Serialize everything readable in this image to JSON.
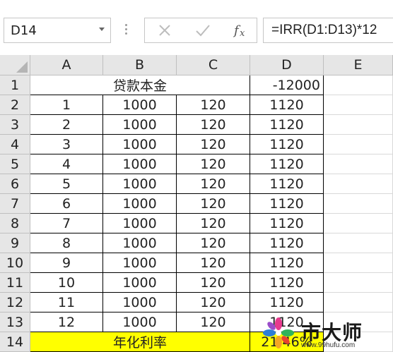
{
  "formula_bar": {
    "name_box": "D14",
    "formula": "=IRR(D1:D13)*12"
  },
  "columns": [
    "A",
    "B",
    "C",
    "D",
    "E"
  ],
  "rows": [
    {
      "num": "1",
      "a": "",
      "b": "贷款本金",
      "c": "",
      "d": "-12000"
    },
    {
      "num": "2",
      "a": "1",
      "b": "1000",
      "c": "120",
      "d": "1120"
    },
    {
      "num": "3",
      "a": "2",
      "b": "1000",
      "c": "120",
      "d": "1120"
    },
    {
      "num": "4",
      "a": "3",
      "b": "1000",
      "c": "120",
      "d": "1120"
    },
    {
      "num": "5",
      "a": "4",
      "b": "1000",
      "c": "120",
      "d": "1120"
    },
    {
      "num": "6",
      "a": "5",
      "b": "1000",
      "c": "120",
      "d": "1120"
    },
    {
      "num": "7",
      "a": "6",
      "b": "1000",
      "c": "120",
      "d": "1120"
    },
    {
      "num": "8",
      "a": "7",
      "b": "1000",
      "c": "120",
      "d": "1120"
    },
    {
      "num": "9",
      "a": "8",
      "b": "1000",
      "c": "120",
      "d": "1120"
    },
    {
      "num": "10",
      "a": "9",
      "b": "1000",
      "c": "120",
      "d": "1120"
    },
    {
      "num": "11",
      "a": "10",
      "b": "1000",
      "c": "120",
      "d": "1120"
    },
    {
      "num": "12",
      "a": "11",
      "b": "1000",
      "c": "120",
      "d": "1120"
    },
    {
      "num": "13",
      "a": "12",
      "b": "1000",
      "c": "120",
      "d": "1120"
    },
    {
      "num": "14",
      "a": "",
      "b": "年化利率",
      "c": "",
      "d": "21.46%"
    }
  ],
  "highlight_color": "#ffff00",
  "watermark": {
    "text": "市大师",
    "url": "www.99hufu.com"
  }
}
